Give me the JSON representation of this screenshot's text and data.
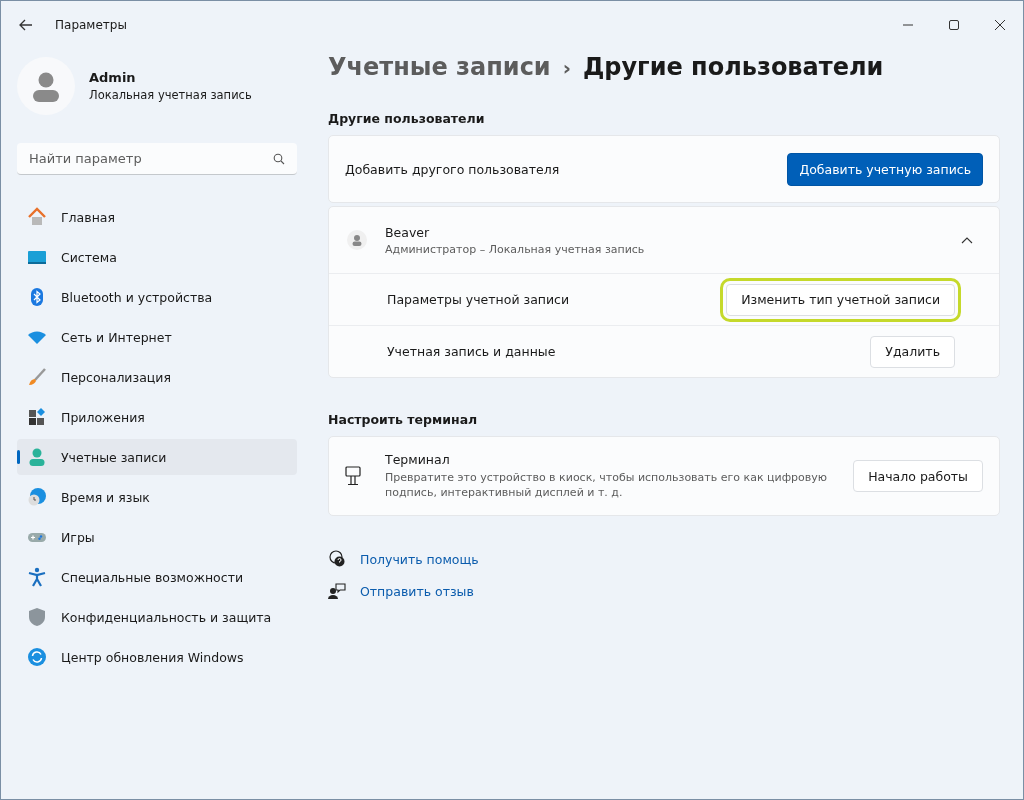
{
  "window": {
    "title": "Параметры"
  },
  "profile": {
    "name": "Admin",
    "subtitle": "Локальная учетная запись"
  },
  "search": {
    "placeholder": "Найти параметр"
  },
  "sidebar": {
    "items": [
      {
        "label": "Главная",
        "selected": false
      },
      {
        "label": "Система",
        "selected": false
      },
      {
        "label": "Bluetooth и устройства",
        "selected": false
      },
      {
        "label": "Сеть и Интернет",
        "selected": false
      },
      {
        "label": "Персонализация",
        "selected": false
      },
      {
        "label": "Приложения",
        "selected": false
      },
      {
        "label": "Учетные записи",
        "selected": true
      },
      {
        "label": "Время и язык",
        "selected": false
      },
      {
        "label": "Игры",
        "selected": false
      },
      {
        "label": "Специальные возможности",
        "selected": false
      },
      {
        "label": "Конфиденциальность и защита",
        "selected": false
      },
      {
        "label": "Центр обновления Windows",
        "selected": false
      }
    ]
  },
  "breadcrumb": {
    "parent": "Учетные записи",
    "separator": "›",
    "current": "Другие пользователи"
  },
  "other_users": {
    "heading": "Другие пользователи",
    "add_label": "Добавить другого пользователя",
    "add_button": "Добавить учетную запись",
    "user": {
      "name": "Beaver",
      "subtitle": "Администратор – Локальная учетная запись",
      "expanded": true,
      "rows": [
        {
          "label": "Параметры учетной записи",
          "button": "Изменить тип учетной записи",
          "highlighted": true
        },
        {
          "label": "Учетная запись и данные",
          "button": "Удалить",
          "highlighted": false
        }
      ]
    }
  },
  "kiosk": {
    "heading": "Настроить терминал",
    "title": "Терминал",
    "description": "Превратите это устройство в киоск, чтобы использовать его как цифровую подпись, интерактивный дисплей и т. д.",
    "button": "Начало работы"
  },
  "links": [
    {
      "kind": "help",
      "label": "Получить помощь"
    },
    {
      "kind": "feedback",
      "label": "Отправить отзыв"
    }
  ]
}
